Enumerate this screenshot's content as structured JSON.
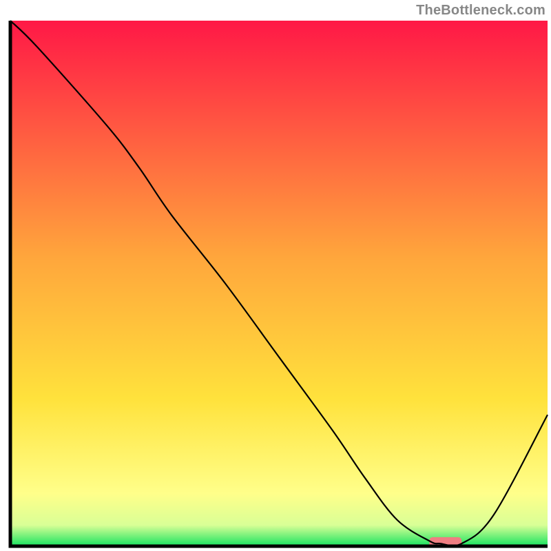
{
  "watermark": "TheBottleneck.com",
  "chart_data": {
    "type": "line",
    "title": "",
    "xlabel": "",
    "ylabel": "",
    "xlim": [
      0,
      100
    ],
    "ylim": [
      0,
      100
    ],
    "grid": false,
    "series": [
      {
        "name": "bottleneck-curve",
        "x": [
          0,
          5,
          18,
          24,
          30,
          40,
          50,
          60,
          66,
          72,
          78,
          80,
          84,
          90,
          100
        ],
        "y": [
          100,
          95,
          80,
          72,
          63,
          50,
          36,
          22,
          13,
          5,
          1,
          0.5,
          0.5,
          6,
          25
        ]
      }
    ],
    "marker": {
      "name": "optimal-marker",
      "x_range": [
        78,
        84
      ],
      "y": 0,
      "color": "#ef7e82",
      "height": 1.2
    },
    "gradient_stops": [
      {
        "pos": 0.0,
        "color": "#ff1846"
      },
      {
        "pos": 0.45,
        "color": "#ffa63c"
      },
      {
        "pos": 0.72,
        "color": "#ffe23c"
      },
      {
        "pos": 0.9,
        "color": "#ffff8a"
      },
      {
        "pos": 0.96,
        "color": "#d9ff96"
      },
      {
        "pos": 1.0,
        "color": "#16e360"
      }
    ],
    "axis_color": "#000000",
    "line_color": "#000000",
    "line_width": 2.2
  }
}
